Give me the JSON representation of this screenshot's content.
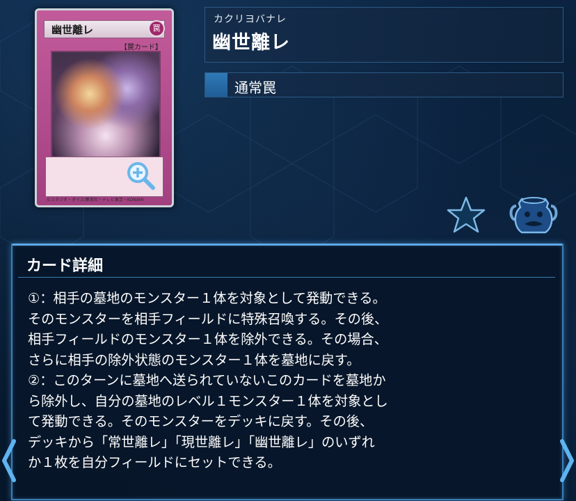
{
  "card": {
    "image_name": "幽世離レ",
    "image_attribute": "罠",
    "image_type_line": "【罠カード】",
    "image_copyright": "©スタジオ・ダイス/集英社・テレビ東京・KONAMI"
  },
  "header": {
    "ruby": "カクリヨバナレ",
    "name": "幽世離レ",
    "type": "通常罠"
  },
  "detail": {
    "title": "カード詳細",
    "lines": [
      "①：相手の墓地のモンスター１体を対象として発動できる。",
      "そのモンスターを相手フィールドに特殊召喚する。その後、",
      "相手フィールドのモンスター１体を除外できる。その場合、",
      "さらに相手の除外状態のモンスター１体を墓地に戻す。",
      "②：このターンに墓地へ送られていないこのカードを墓地か",
      "ら除外し、自分の墓地のレベル１モンスター１体を対象とし",
      "て発動できる。そのモンスターをデッキに戻す。その後、",
      "デッキから「常世離レ」「現世離レ」「幽世離レ」のいずれ",
      "か１枚を自分フィールドにセットできる。"
    ]
  },
  "icons": {
    "zoom": "zoom-in-icon",
    "favorite": "star-icon",
    "pot": "pot-of-greed-icon",
    "prev": "chevron-left-icon",
    "next": "chevron-right-icon"
  },
  "colors": {
    "accent": "#2f79b8",
    "panel_border": "#3a7fb7",
    "background": "#06182e",
    "trap_card": "#b04b8c"
  }
}
